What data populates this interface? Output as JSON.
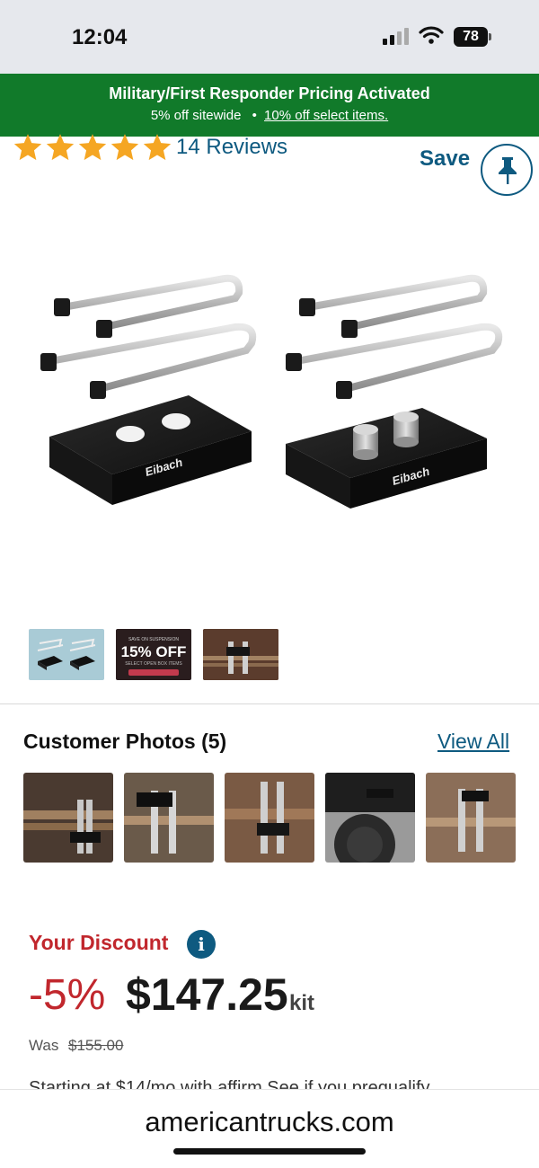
{
  "status_bar": {
    "time": "12:04",
    "battery": "78"
  },
  "promo_banner": {
    "title": "Military/First Responder Pricing Activated",
    "sitewide": "5% off sitewide",
    "bullet": "•",
    "select_link": "10% off select items.",
    "background_color": "#117a2a"
  },
  "rating": {
    "stars": 5,
    "reviews_label": "14 Reviews"
  },
  "save": {
    "label": "Save",
    "icon": "pushpin-icon"
  },
  "thumbnails": [
    {
      "name": "thumb-kit"
    },
    {
      "name": "thumb-promo",
      "small_text": "SAVE ON SUSPENSION",
      "big_text": "15% OFF",
      "sub_text": "SELECT OPEN BOX ITEMS"
    },
    {
      "name": "thumb-installed"
    }
  ],
  "customer_photos": {
    "title": "Customer Photos (5)",
    "view_all": "View All",
    "count": 5
  },
  "pricing": {
    "discount_label": "Your Discount",
    "discount_pct": "-5%",
    "price": "$147.25",
    "unit": "kit",
    "was_label": "Was",
    "was_price": "$155.00",
    "accent_color": "#c1272d"
  },
  "cut_off_text": "Starting at $14/mo with affirm  See if you prequalify",
  "browser": {
    "url": "americantrucks.com"
  }
}
